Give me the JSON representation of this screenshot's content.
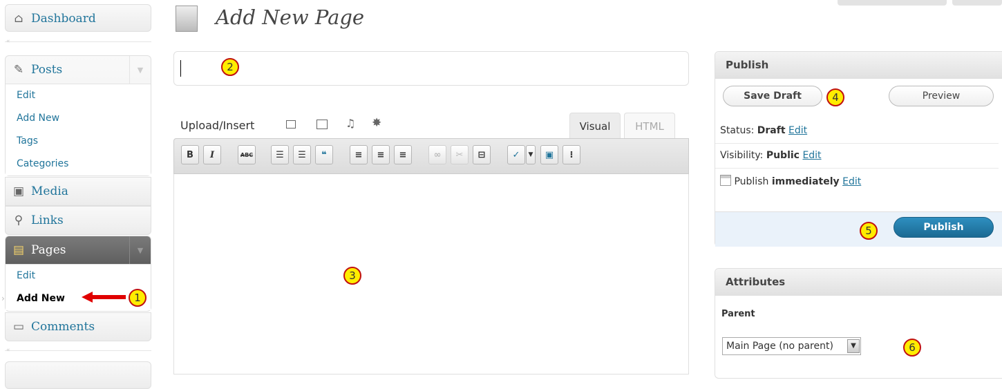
{
  "sidebar": {
    "dashboard": "Dashboard",
    "posts": {
      "label": "Posts",
      "items": [
        "Edit",
        "Add New",
        "Tags",
        "Categories"
      ]
    },
    "media": "Media",
    "links": "Links",
    "pages": {
      "label": "Pages",
      "items": [
        "Edit",
        "Add New"
      ]
    },
    "comments": "Comments"
  },
  "page_title": "Add New Page",
  "editor": {
    "upload_label": "Upload/Insert",
    "tab_visual": "Visual",
    "tab_html": "HTML",
    "toolbar": [
      "B",
      "I",
      "ABC"
    ]
  },
  "publish_box": {
    "title": "Publish",
    "save_draft": "Save Draft",
    "preview": "Preview",
    "status_label": "Status:",
    "status_value": "Draft",
    "visibility_label": "Visibility:",
    "visibility_value": "Public",
    "publish_label": "Publish",
    "publish_value": "immediately",
    "edit": "Edit",
    "publish_button": "Publish"
  },
  "attributes_box": {
    "title": "Attributes",
    "parent_label": "Parent",
    "parent_value": "Main Page (no parent)"
  },
  "callouts": [
    "1",
    "2",
    "3",
    "4",
    "5",
    "6"
  ],
  "colors": {
    "link": "#21759b",
    "menu_active": "#6d6d6d",
    "publish_button": "#21759b",
    "callout_fill": "#ffed00",
    "arrow": "#e00000"
  }
}
